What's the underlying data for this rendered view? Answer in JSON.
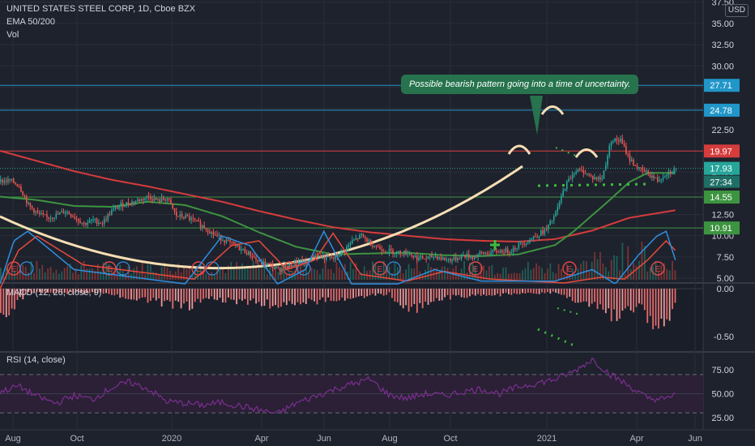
{
  "legend": {
    "symbol": "UNITED STATES STEEL CORP, 1D, Cboe BZX",
    "ema": "EMA 50/200",
    "vol": "Vol",
    "macd": "MACD (12, 26, close, 9)",
    "rsi": "RSI (14, close)"
  },
  "currency": "USD",
  "annotation": "Possible bearish pattern going into a time of uncertainty.",
  "colors": {
    "background": "#1e222d",
    "ema50": "#3d9440",
    "ema200": "#d63c3c",
    "cup_curve": "#f5deb3",
    "annotation_bg": "#26734d",
    "up_candle": "#26a69a",
    "down_candle": "#ef5350",
    "macd_line": "#2f8fe0",
    "signal_line": "#e84a3c",
    "rsi_line": "#7b2f8f",
    "green_marker": "#3dbd3d"
  },
  "chart_data": [
    {
      "type": "line",
      "title": "UNITED STATES STEEL CORP, 1D, Cboe BZX",
      "x_ticks": [
        "Aug",
        "Oct",
        "2020",
        "Apr",
        "Jun",
        "Aug",
        "Oct",
        "2021",
        "Apr",
        "Jun"
      ],
      "y_ticks": [
        5.0,
        7.5,
        10.0,
        12.5,
        15.0,
        17.5,
        20.0,
        22.5,
        25.0,
        27.5,
        30.0,
        32.5,
        35.0,
        37.5
      ],
      "ylim": [
        5.0,
        37.5
      ],
      "price_lines": [
        {
          "value": 27.71,
          "label": "27.71",
          "color": "#2196c8"
        },
        {
          "value": 24.78,
          "label": "24.78",
          "color": "#2196c8"
        },
        {
          "value": 19.97,
          "label": "19.97",
          "color": "#d63c3c"
        },
        {
          "value": 17.93,
          "label": "17.93",
          "color": "#26a69a"
        },
        {
          "value": 14.55,
          "label": "14.55",
          "color": "#3d9440"
        },
        {
          "value": 10.91,
          "label": "10.91",
          "color": "#3d9440"
        }
      ],
      "countdown_label": "27:34",
      "series": [
        {
          "name": "Price",
          "x": [
            0,
            10,
            20,
            30,
            40,
            50,
            60,
            70,
            80,
            90,
            100,
            110,
            120,
            130,
            140,
            150,
            160,
            170,
            180,
            190,
            200,
            210,
            220,
            230,
            240,
            250,
            260,
            270,
            280,
            290,
            300,
            310,
            320,
            330,
            340,
            350,
            360,
            370,
            380,
            390,
            400,
            410,
            420,
            430,
            440,
            450,
            460,
            470,
            480,
            490,
            500,
            510,
            520,
            530,
            540,
            550,
            560,
            570,
            580,
            590,
            600,
            610,
            620,
            630,
            640,
            650,
            660,
            670,
            680,
            690,
            700,
            710,
            720,
            730
          ],
          "values": [
            16.4,
            16.5,
            15.9,
            13.6,
            12.6,
            12.1,
            12.4,
            12.9,
            12.2,
            11.4,
            11.8,
            11.5,
            12.9,
            13.6,
            13.9,
            14.2,
            14.6,
            14.1,
            14.4,
            12.3,
            12.2,
            11.7,
            11.0,
            10.2,
            9.6,
            9.0,
            8.4,
            7.8,
            6.8,
            6.6,
            6.0,
            6.3,
            6.9,
            6.8,
            7.7,
            7.4,
            7.3,
            8.1,
            9.3,
            10.0,
            9.1,
            8.5,
            8.2,
            8.0,
            8.0,
            7.4,
            7.3,
            7.6,
            7.2,
            7.2,
            7.7,
            7.5,
            7.9,
            8.0,
            8.2,
            8.2,
            8.9,
            9.4,
            10.1,
            10.7,
            12.6,
            15.8,
            17.6,
            17.6,
            16.8,
            16.7,
            21.3,
            21.2,
            19.0,
            17.8,
            17.3,
            16.5,
            17.4,
            17.8
          ]
        },
        {
          "name": "EMA 50",
          "x": [
            0,
            40,
            80,
            120,
            160,
            200,
            240,
            280,
            320,
            360,
            400,
            440,
            480,
            520,
            560,
            600,
            620,
            640,
            660,
            680,
            700,
            730
          ],
          "values": [
            14.6,
            14.2,
            13.5,
            13.4,
            14.0,
            13.6,
            12.3,
            10.4,
            8.7,
            7.8,
            7.9,
            8.0,
            7.7,
            7.6,
            7.8,
            8.9,
            10.5,
            12.4,
            14.3,
            16.3,
            17.4,
            17.4
          ]
        },
        {
          "name": "EMA 200",
          "x": [
            0,
            40,
            80,
            120,
            160,
            200,
            240,
            280,
            320,
            360,
            400,
            440,
            480,
            520,
            560,
            600,
            640,
            680,
            730
          ],
          "values": [
            20.0,
            18.8,
            17.6,
            16.6,
            15.8,
            14.9,
            14.0,
            12.9,
            11.9,
            11.0,
            10.4,
            10.0,
            9.6,
            9.4,
            9.3,
            9.6,
            10.6,
            12.1,
            13.0
          ]
        }
      ]
    },
    {
      "type": "bar",
      "title": "MACD (12, 26, close, 9)",
      "y_ticks": [
        0.0,
        -0.5
      ],
      "ylim": [
        -0.68,
        0.0
      ]
    },
    {
      "type": "line",
      "title": "RSI (14, close)",
      "y_ticks": [
        25.0,
        50.0,
        75.0
      ],
      "ylim": [
        20,
        95
      ],
      "bands": [
        30,
        70
      ],
      "series": [
        {
          "name": "RSI",
          "x": [
            0,
            20,
            40,
            60,
            80,
            100,
            120,
            140,
            160,
            180,
            200,
            220,
            240,
            260,
            280,
            300,
            320,
            340,
            360,
            380,
            400,
            420,
            440,
            460,
            480,
            500,
            520,
            540,
            560,
            580,
            600,
            620,
            640,
            660,
            680,
            700,
            720,
            730
          ],
          "values": [
            52,
            58,
            47,
            40,
            48,
            44,
            56,
            62,
            55,
            42,
            40,
            38,
            41,
            37,
            33,
            29,
            40,
            47,
            54,
            60,
            65,
            49,
            45,
            50,
            48,
            52,
            55,
            50,
            57,
            61,
            65,
            73,
            86,
            70,
            58,
            45,
            44,
            51
          ]
        }
      ]
    }
  ]
}
